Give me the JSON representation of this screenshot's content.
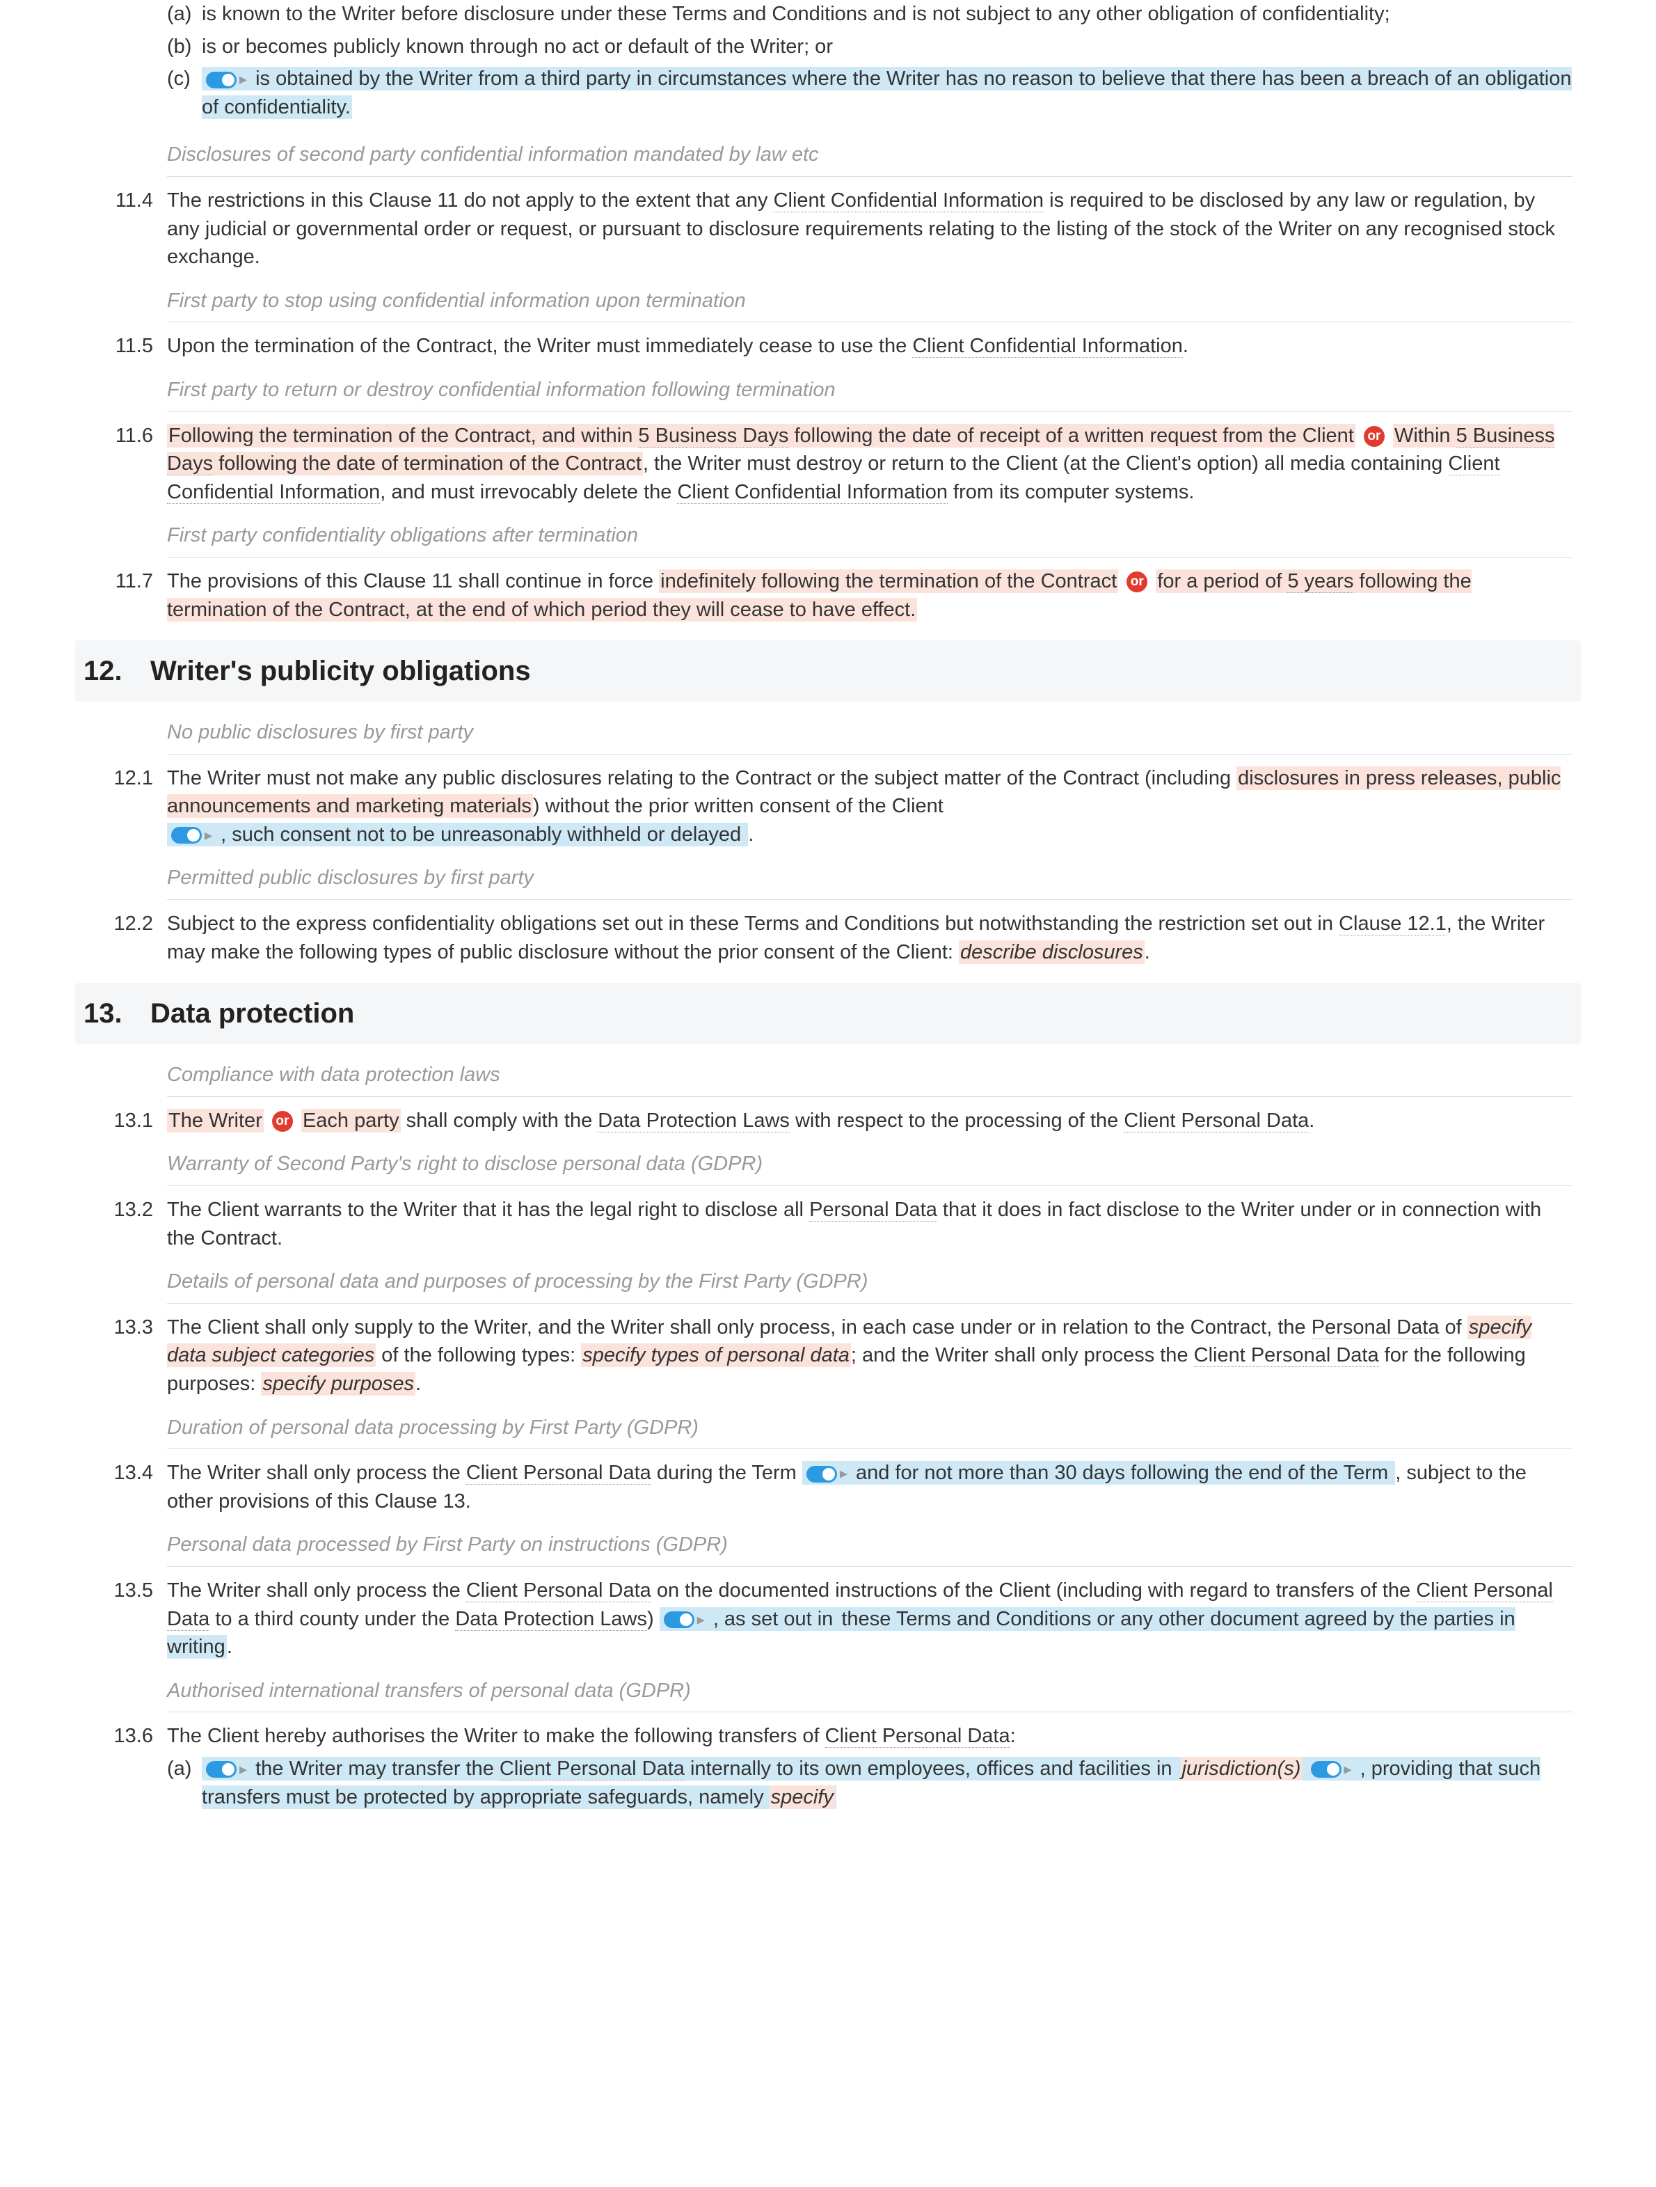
{
  "clauses_intro": {
    "a_letter": "(a)",
    "a_text": "is known to the Writer before disclosure under these Terms and Conditions and is not subject to any other obligation of confidentiality;",
    "b_letter": "(b)",
    "b_text": "is or becomes publicly known through no act or default of the Writer; or",
    "c_letter": "(c)",
    "c_text": "is obtained by the Writer from a third party in circumstances where the Writer has no reason to believe that there has been a breach of an obligation of confidentiality."
  },
  "cap_11_4": "Disclosures of second party confidential information mandated by law etc",
  "c11_4": {
    "num": "11.4",
    "text1": "The restrictions in this Clause 11 do not apply to the extent that any ",
    "term1": "Client Confidential Information",
    "text2": " is required to be disclosed by any law or regulation, by any judicial or governmental order or request, or pursuant to disclosure requirements relating to the listing of the stock of the Writer on any recognised stock exchange."
  },
  "cap_11_5": "First party to stop using confidential information upon termination",
  "c11_5": {
    "num": "11.5",
    "text1": "Upon the termination of the Contract, the Writer must immediately cease to use the ",
    "term1": "Client Confidential Information",
    "text2": "."
  },
  "cap_11_6": "First party to return or destroy confidential information following termination",
  "c11_6": {
    "num": "11.6",
    "hl1": "Following the termination of the Contract, and within ",
    "hl1b": "5 Business Days",
    "hl1c": " following the date of receipt of a written request from the Client",
    "or": "or",
    "hl2a": "Within ",
    "hl2b": "5 Business Days",
    "hl2c": " following the date of termination of the Contract",
    "text1": ", the Writer must destroy or return to the Client (at the Client's option) all media containing ",
    "term1": "Client Confidential Information",
    "text2": ", and must irrevocably delete the ",
    "term2": "Client Confidential Information",
    "text3": " from its computer systems."
  },
  "cap_11_7": "First party confidentiality obligations after termination",
  "c11_7": {
    "num": "11.7",
    "text1": "The provisions of this Clause 11 shall continue in force ",
    "hl1": "indefinitely following the termination of the Contract",
    "or": "or",
    "hl2a": "for a period of ",
    "hl2b": "5 years",
    "hl2c": " following the termination of the Contract, at the end of which period they will cease to have effect."
  },
  "sec12": {
    "num": "12.",
    "title": "Writer's publicity obligations"
  },
  "cap_12_1": "No public disclosures by first party",
  "c12_1": {
    "num": "12.1",
    "text1": "The Writer must not make any public disclosures relating to the Contract or the subject matter of the Contract (including ",
    "pink1": "disclosures in press releases, public announcements and marketing materials",
    "text2": ") without the prior written consent of the Client ",
    "hl1": ", such consent not to be unreasonably withheld or delayed",
    "text3": "."
  },
  "cap_12_2": "Permitted public disclosures by first party",
  "c12_2": {
    "num": "12.2",
    "text1": "Subject to the express confidentiality obligations set out in these Terms and Conditions but notwithstanding the restriction set out in ",
    "link1": "Clause 12.1",
    "text2": ", the Writer may make the following types of public disclosure without the prior consent of the Client: ",
    "italic1": "describe disclosures",
    "text3": "."
  },
  "sec13": {
    "num": "13.",
    "title": "Data protection"
  },
  "cap_13_1": "Compliance with data protection laws",
  "c13_1": {
    "num": "13.1",
    "hl1": "The Writer",
    "or": "or",
    "hl2": "Each party",
    "text1": " shall comply with the ",
    "term1": "Data Protection Laws",
    "text2": " with respect to the processing of the ",
    "term2": "Client Personal Data",
    "text3": "."
  },
  "cap_13_2": "Warranty of Second Party's right to disclose personal data (GDPR)",
  "c13_2": {
    "num": "13.2",
    "text1": "The Client warrants to the Writer that it has the legal right to disclose all ",
    "term1": "Personal Data",
    "text2": " that it does in fact disclose to the Writer under or in connection with the Contract."
  },
  "cap_13_3": "Details of personal data and purposes of processing by the First Party (GDPR)",
  "c13_3": {
    "num": "13.3",
    "text1": "The Client shall only supply to the Writer, and the Writer shall only process, in each case under or in relation to the Contract, the ",
    "term1": "Personal Data",
    "text2": " of ",
    "italic1": "specify data subject categories",
    "text3": " of the following types: ",
    "italic2": "specify types of personal data",
    "text4": "; and the Writer shall only process the ",
    "term2": "Client Personal Data",
    "text5": " for the following purposes: ",
    "italic3": "specify purposes",
    "text6": "."
  },
  "cap_13_4": "Duration of personal data processing by First Party (GDPR)",
  "c13_4": {
    "num": "13.4",
    "text1": "The Writer shall only process the ",
    "term1": "Client Personal Data",
    "text2": " during the Term ",
    "hl1": " and for not more than 30 days following the end of the Term",
    "text3": ", subject to the other provisions of this Clause 13."
  },
  "cap_13_5": "Personal data processed by First Party on instructions (GDPR)",
  "c13_5": {
    "num": "13.5",
    "text1": "The Writer shall only process the ",
    "term1": "Client Personal Data",
    "text2": " on the documented instructions of the Client (including with regard to transfers of the ",
    "term2": "Client Personal Data",
    "text3": " to a third county under the ",
    "term3": "Data Protection Laws",
    "text4": ") ",
    "hl1a": ", as set out in",
    "hl1b": "these Terms and Conditions or any other document agreed by the parties in writing",
    "text5": "."
  },
  "cap_13_6": "Authorised international transfers of personal data (GDPR)",
  "c13_6": {
    "num": "13.6",
    "text1": "The Client hereby authorises the Writer to make the following transfers of ",
    "term1": "Client Personal Data",
    "text2": ":",
    "a_letter": "(a)",
    "a_hl1": " the Writer may transfer the ",
    "a_term1": "Client Personal Data",
    "a_hl2": " internally to its own employees, offices and facilities in ",
    "a_italic1": "jurisdiction(s)",
    "a_hl3": ", providing that such transfers must be protected by appropriate safeguards, namely ",
    "a_italic2": "specify"
  }
}
